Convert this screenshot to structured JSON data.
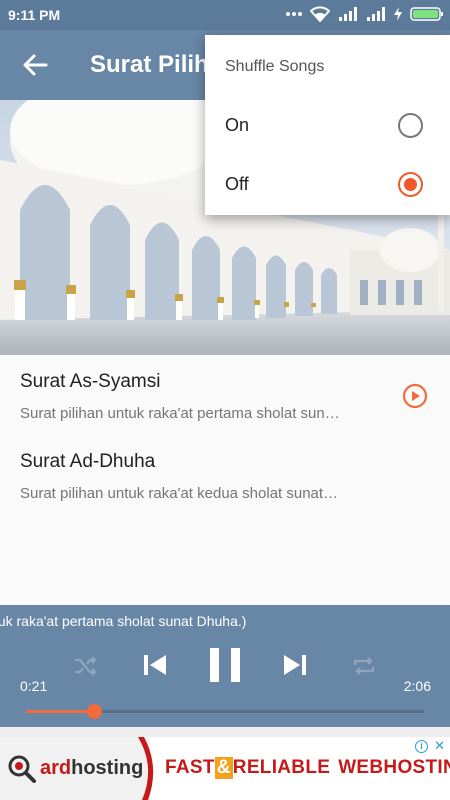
{
  "status_bar": {
    "time": "9:11 PM"
  },
  "app_bar": {
    "title": "Surat Pilihan"
  },
  "hero": {
    "description_icon": "mosque-photo"
  },
  "songs": [
    {
      "title": "Surat As-Syamsi",
      "subtitle": "Surat pilihan untuk raka'at pertama sholat sun…",
      "playing": true
    },
    {
      "title": "Surat Ad-Dhuha",
      "subtitle": "Surat pilihan untuk raka'at kedua sholat sunat…",
      "playing": false
    }
  ],
  "player": {
    "marquee": "ihan untuk raka'at pertama sholat sunat Dhuha.)",
    "elapsed": "0:21",
    "duration": "2:06",
    "progress": 0.17,
    "shuffle_enabled": false,
    "repeat_enabled": false,
    "accent_color": "#f26b3a"
  },
  "ad": {
    "logo_prefix": "ard",
    "logo_suffix": "hosting",
    "text_fast": "FAST",
    "text_amp": "&",
    "text_reliable": "RELIABLE",
    "text_webhosting": "WEBHOSTING",
    "info_glyph": "i",
    "close_glyph": "✕"
  },
  "popup": {
    "title": "Shuffle Songs",
    "options": [
      {
        "label": "On",
        "selected": false
      },
      {
        "label": "Off",
        "selected": true
      }
    ]
  }
}
